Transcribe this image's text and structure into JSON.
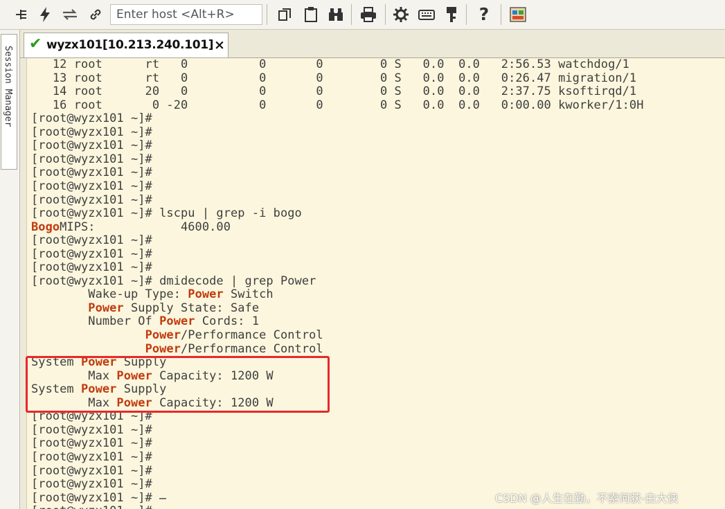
{
  "toolbar": {
    "host_placeholder": "Enter host <Alt+R>",
    "buttons": [
      "new-session",
      "quick-connect",
      "reconnect",
      "connect-link",
      "copy",
      "paste",
      "find",
      "print",
      "settings",
      "keymap",
      "keys",
      "help",
      "sftp"
    ]
  },
  "session_manager": {
    "label": "Session Manager"
  },
  "tab": {
    "title": "wyzx101[10.213.240.101]",
    "close": "×",
    "status_icon": "check-icon",
    "status_color": "#2c9a1e"
  },
  "terminal": {
    "lines": [
      [
        {
          "t": "   12 root      rt   0          0       0        0 S   0.0  0.0   2:56.53 watchdog/1"
        }
      ],
      [
        {
          "t": "   13 root      rt   0          0       0        0 S   0.0  0.0   0:26.47 migration/1"
        }
      ],
      [
        {
          "t": "   14 root      20   0          0       0        0 S   0.0  0.0   2:37.75 ksoftirqd/1"
        }
      ],
      [
        {
          "t": "   16 root       0 -20          0       0        0 S   0.0  0.0   0:00.00 kworker/1:0H"
        }
      ],
      [
        {
          "t": "[root@wyzx101 ~]#"
        }
      ],
      [
        {
          "t": "[root@wyzx101 ~]#"
        }
      ],
      [
        {
          "t": "[root@wyzx101 ~]#"
        }
      ],
      [
        {
          "t": "[root@wyzx101 ~]#"
        }
      ],
      [
        {
          "t": "[root@wyzx101 ~]#"
        }
      ],
      [
        {
          "t": "[root@wyzx101 ~]#"
        }
      ],
      [
        {
          "t": "[root@wyzx101 ~]#"
        }
      ],
      [
        {
          "t": "[root@wyzx101 ~]# lscpu | grep -i bogo"
        }
      ],
      [
        {
          "t": "Bogo",
          "hl": true
        },
        {
          "t": "MIPS:            4600.00"
        }
      ],
      [
        {
          "t": "[root@wyzx101 ~]#"
        }
      ],
      [
        {
          "t": "[root@wyzx101 ~]#"
        }
      ],
      [
        {
          "t": "[root@wyzx101 ~]#"
        }
      ],
      [
        {
          "t": "[root@wyzx101 ~]# dmidecode | grep Power"
        }
      ],
      [
        {
          "t": "        Wake-up Type: "
        },
        {
          "t": "Power",
          "hl": true
        },
        {
          "t": " Switch"
        }
      ],
      [
        {
          "t": "        "
        },
        {
          "t": "Power",
          "hl": true
        },
        {
          "t": " Supply State: Safe"
        }
      ],
      [
        {
          "t": "        Number Of "
        },
        {
          "t": "Power",
          "hl": true
        },
        {
          "t": " Cords: 1"
        }
      ],
      [
        {
          "t": "                "
        },
        {
          "t": "Power",
          "hl": true
        },
        {
          "t": "/Performance Control"
        }
      ],
      [
        {
          "t": "                "
        },
        {
          "t": "Power",
          "hl": true
        },
        {
          "t": "/Performance Control"
        }
      ],
      [
        {
          "t": "System "
        },
        {
          "t": "Power",
          "hl": true
        },
        {
          "t": " Supply"
        }
      ],
      [
        {
          "t": "        Max "
        },
        {
          "t": "Power",
          "hl": true
        },
        {
          "t": " Capacity: 1200 W"
        }
      ],
      [
        {
          "t": "System "
        },
        {
          "t": "Power",
          "hl": true
        },
        {
          "t": " Supply"
        }
      ],
      [
        {
          "t": "        Max "
        },
        {
          "t": "Power",
          "hl": true
        },
        {
          "t": " Capacity: 1200 W"
        }
      ],
      [
        {
          "t": "[root@wyzx101 ~]#"
        }
      ],
      [
        {
          "t": "[root@wyzx101 ~]#"
        }
      ],
      [
        {
          "t": "[root@wyzx101 ~]#"
        }
      ],
      [
        {
          "t": "[root@wyzx101 ~]#"
        }
      ],
      [
        {
          "t": "[root@wyzx101 ~]#"
        }
      ],
      [
        {
          "t": "[root@wyzx101 ~]#"
        }
      ],
      [
        {
          "t": "[root@wyzx101 ~]# ",
          "cursor": true
        }
      ],
      [
        {
          "t": "[root@wyzx101 ~]#"
        }
      ]
    ],
    "highlight_color": "#c13a0f",
    "annotation_box_color": "#e8282b"
  },
  "watermark": "CSDN @人生在勤，不索何获-白大侠"
}
